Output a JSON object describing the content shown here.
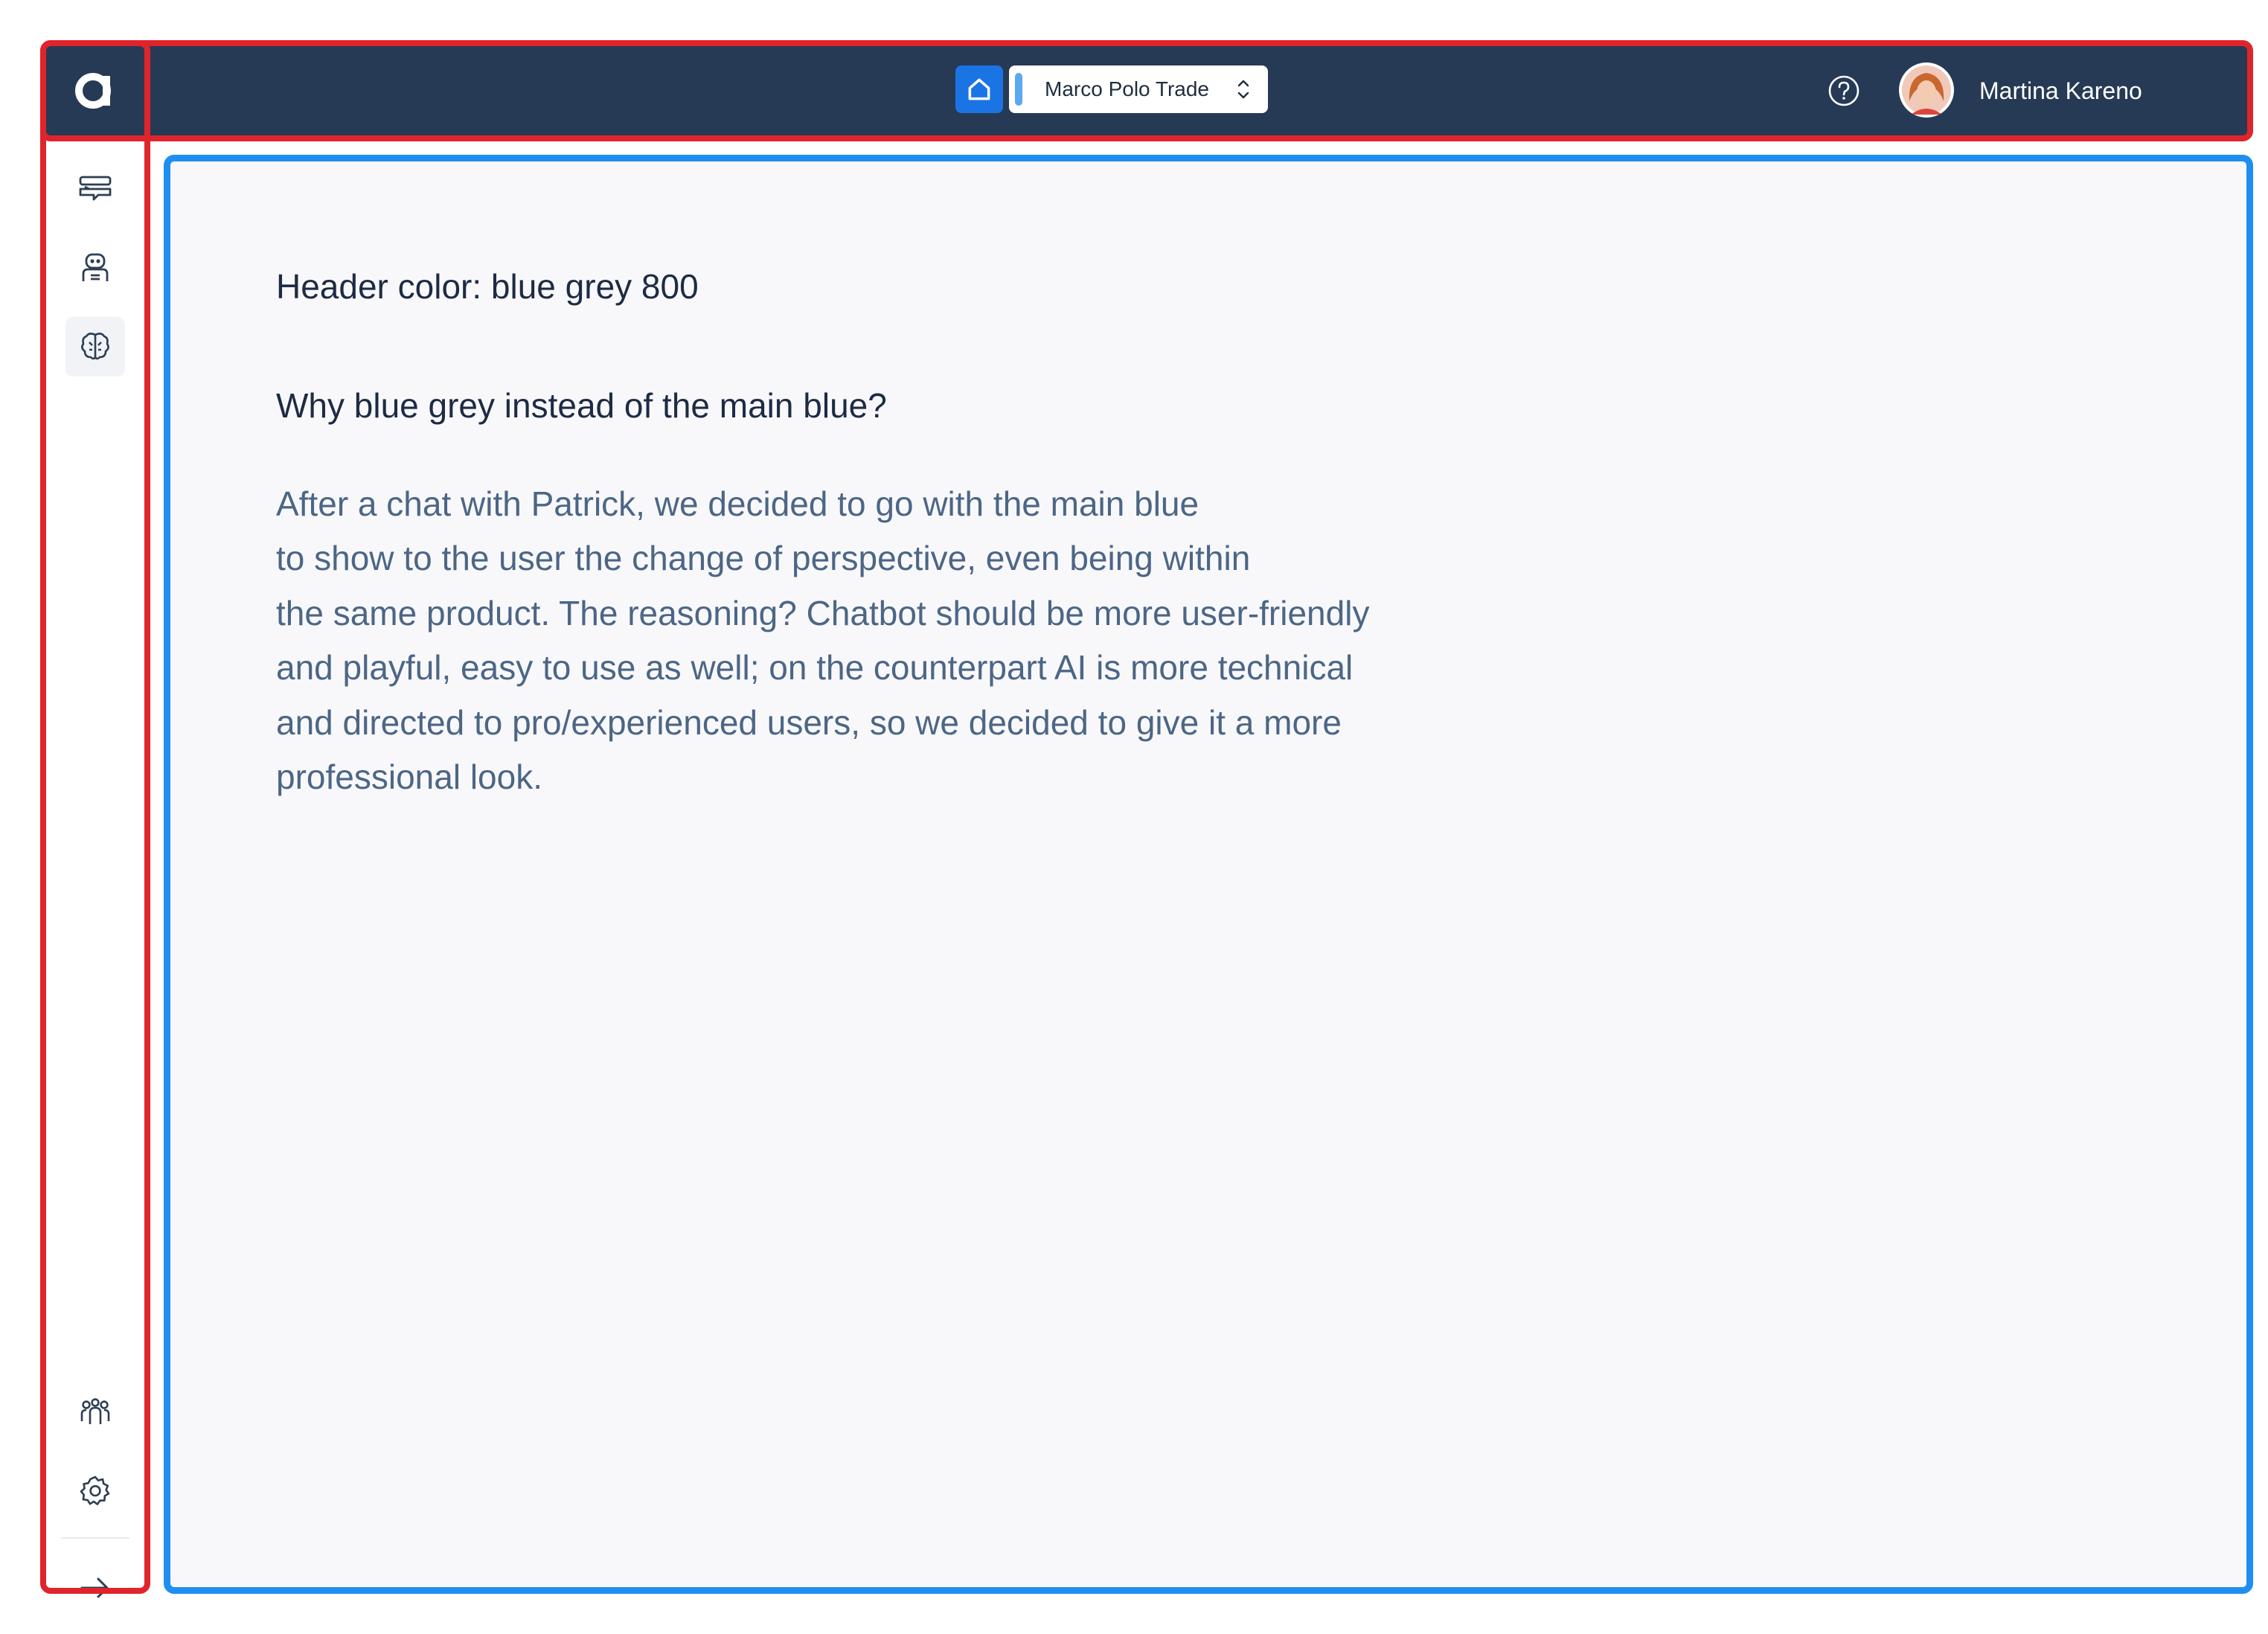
{
  "header": {
    "workspace_name": "Marco Polo Trade",
    "user_name": "Martina Kareno",
    "background_color": "#263a55",
    "home_button_color": "#1b74e4"
  },
  "icons": {
    "logo": "app-logo-icon",
    "home": "home-icon",
    "workspace_select": "chevron-up-down-icon",
    "help": "help-circle-icon",
    "sidebar": [
      "chat-icon",
      "bot-icon",
      "ai-brain-icon",
      "team-icon",
      "settings-gear-icon",
      "arrow-right-icon"
    ]
  },
  "main": {
    "heading": "Header color: blue grey 800",
    "subheading": "Why blue grey instead of the main blue?",
    "paragraph_lines": [
      "After a chat with Patrick, we decided to go with the main blue",
      "to show to the user the change of perspective, even being within",
      "the same product. The reasoning? Chatbot should be more user-friendly",
      "and playful, easy to use as well; on the counterpart AI is more technical",
      "and directed to pro/experienced users, so we decided to give it a more",
      "professional look."
    ]
  },
  "annotations": {
    "red_outline_color": "#e0242b",
    "blue_outline_color": "#1e8ff0"
  }
}
